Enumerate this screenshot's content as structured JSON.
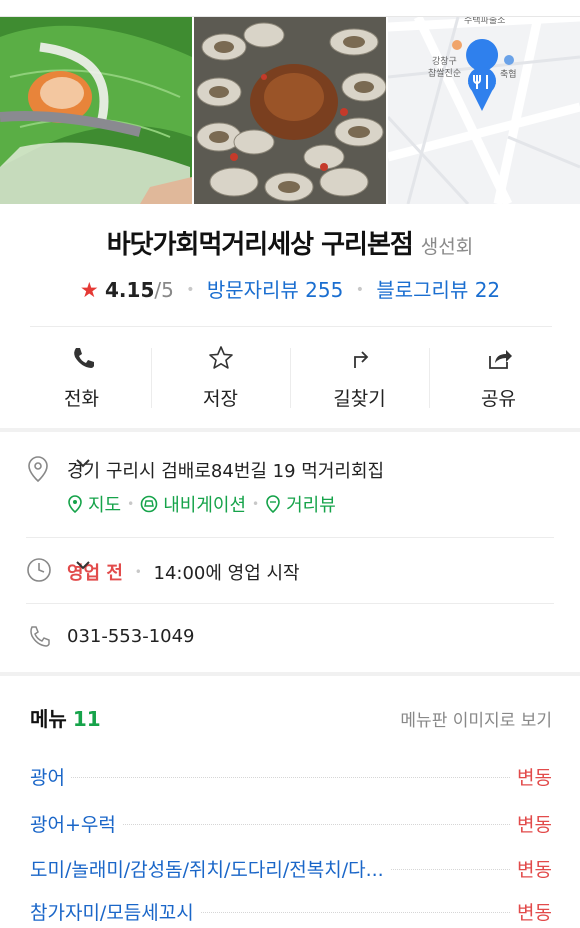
{
  "photos": {
    "map_labels": [
      "수택파출소",
      "강창구",
      "찹쌀진순",
      "축협"
    ]
  },
  "place": {
    "name": "바닷가회먹거리세상 구리본점",
    "category": "생선회",
    "rating": "4.15",
    "rating_max": "/5",
    "visitor_reviews": "방문자리뷰 255",
    "blog_reviews": "블로그리뷰 22"
  },
  "actions": [
    {
      "label": "전화",
      "icon": "phone-icon"
    },
    {
      "label": "저장",
      "icon": "star-outline-icon"
    },
    {
      "label": "길찾기",
      "icon": "directions-icon"
    },
    {
      "label": "공유",
      "icon": "share-icon"
    }
  ],
  "address": {
    "text": "경기 구리시 검배로84번길 19 먹거리회집",
    "links": [
      "지도",
      "내비게이션",
      "거리뷰"
    ]
  },
  "hours": {
    "status": "영업 전",
    "detail": "14:00에 영업 시작"
  },
  "phone": "031-553-1049",
  "menu": {
    "title": "메뉴",
    "count": "11",
    "view_image": "메뉴판 이미지로 보기",
    "items": [
      {
        "name": "광어",
        "price": "변동"
      },
      {
        "name": "광어+우럭",
        "price": "변동"
      },
      {
        "name": "도미/놀래미/감성돔/쥐치/도다리/전복치/다...",
        "price": "변동"
      },
      {
        "name": "참가자미/모듬세꼬시",
        "price": "변동"
      }
    ]
  },
  "colors": {
    "link_blue": "#1a6ed0",
    "green": "#16a34a",
    "red": "#e24b4b",
    "star": "#e53935"
  }
}
